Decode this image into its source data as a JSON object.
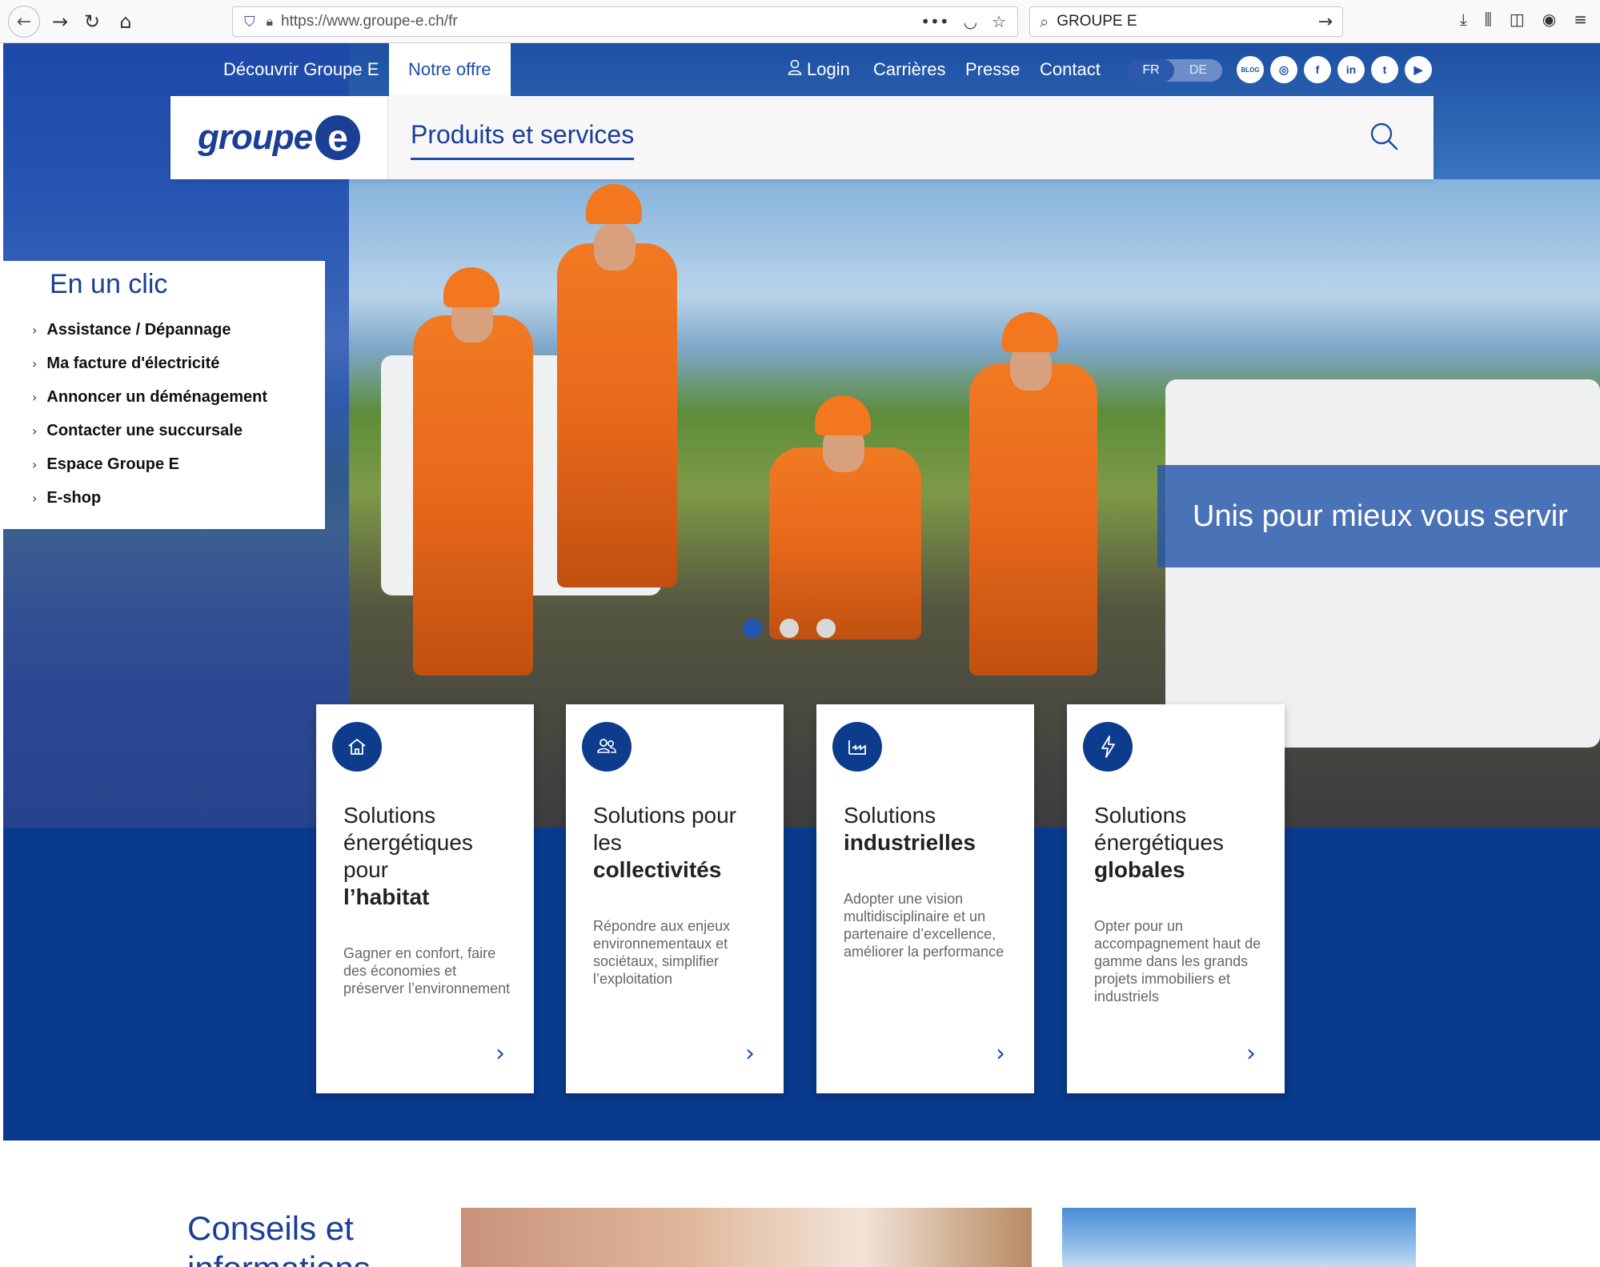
{
  "browser": {
    "url": "https://www.groupe-e.ch/fr",
    "search_query": "GROUPE E",
    "icons": [
      "back-icon",
      "forward-icon",
      "reload-icon",
      "home-icon",
      "shield-icon",
      "lock-icon",
      "more-icon",
      "pocket-icon",
      "star-icon",
      "search-icon",
      "go-arrow-icon",
      "download-icon",
      "library-icon",
      "sidebar-icon",
      "account-icon",
      "menu-icon"
    ]
  },
  "topnav": {
    "discover": "Découvrir Groupe E",
    "offer": "Notre offre",
    "login": "Login",
    "careers": "Carrières",
    "press": "Presse",
    "contact": "Contact",
    "lang_fr": "FR",
    "lang_de": "DE",
    "blog": "BLOG"
  },
  "brand": {
    "logo_text": "groupe",
    "logo_letter": "e",
    "products_tab": "Produits et services",
    "accent": "#1c4ea8",
    "dark_blue": "#083a8d"
  },
  "clic": {
    "title": "En un clic",
    "items": [
      "Assistance / Dépannage",
      "Ma facture d'électricité",
      "Annoncer un déménagement",
      "Contacter une succursale",
      "Espace Groupe E",
      "E-shop"
    ]
  },
  "hero": {
    "slogan": "Unis pour mieux vous servir",
    "slide_count": 3,
    "active_slide": 1
  },
  "cards": [
    {
      "icon": "house-icon",
      "title_pre": "Solutions énergétiques pour",
      "title_bold": "l’habitat",
      "desc": "Gagner en confort, faire des économies et préserver l’environnement"
    },
    {
      "icon": "people-icon",
      "title_pre": "Solutions pour les",
      "title_bold": "collectivités",
      "desc": "Répondre aux enjeux environnementaux et sociétaux, simplifier l’exploitation"
    },
    {
      "icon": "factory-icon",
      "title_pre": "Solutions",
      "title_bold": "industrielles",
      "desc": "Adopter une vision multidisciplinaire et un partenaire d’excellence, améliorer la performance"
    },
    {
      "icon": "lightning-icon",
      "title_pre": "Solutions énergétiques",
      "title_bold": "globales",
      "desc": "Opter pour un accompagnement haut de gamme dans les grands projets immobiliers et industriels"
    }
  ],
  "lower": {
    "title": "Conseils et informations"
  }
}
